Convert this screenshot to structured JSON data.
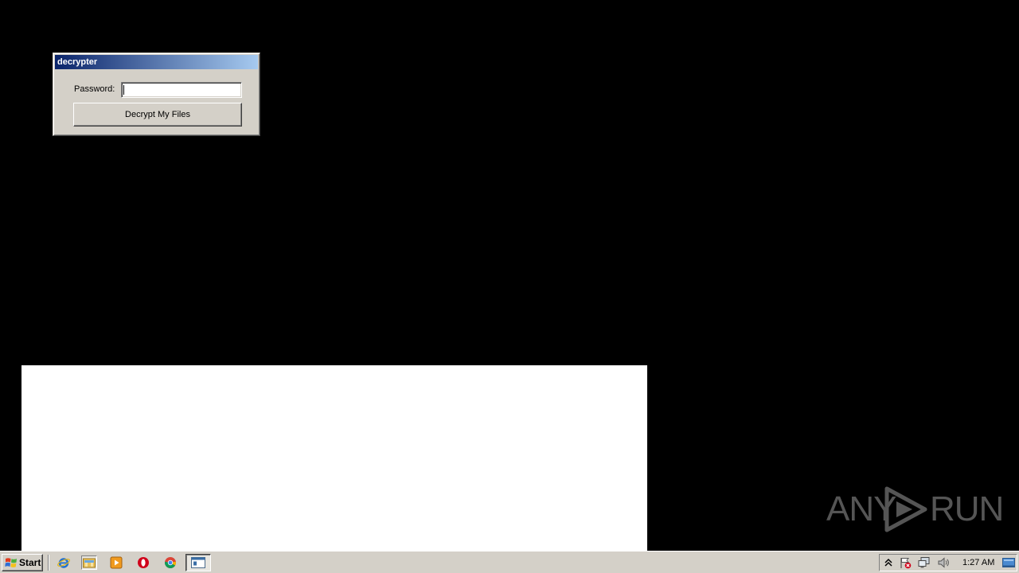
{
  "window": {
    "title": "decrypter",
    "password_label": "Password:",
    "password_value": "",
    "decrypt_button_label": "Decrypt My Files"
  },
  "watermark": {
    "left_text": "ANY",
    "right_text": "RUN"
  },
  "taskbar": {
    "start_label": "Start",
    "quick_launch": [
      {
        "name": "internet-explorer-icon"
      },
      {
        "name": "file-explorer-icon"
      },
      {
        "name": "media-player-icon"
      },
      {
        "name": "opera-icon"
      },
      {
        "name": "chrome-icon"
      }
    ],
    "open_task": {
      "name": "decrypter-task-icon"
    },
    "tray": {
      "icons": [
        "show-hidden-icons-icon",
        "action-center-flag-icon",
        "network-icon",
        "volume-icon"
      ],
      "clock": "1:27 AM"
    }
  },
  "colors": {
    "desktop": "#000000",
    "title_gradient_start": "#0a246a",
    "title_gradient_end": "#a6caf0",
    "taskbar": "#d4d0c8",
    "watermark": "#555555"
  }
}
